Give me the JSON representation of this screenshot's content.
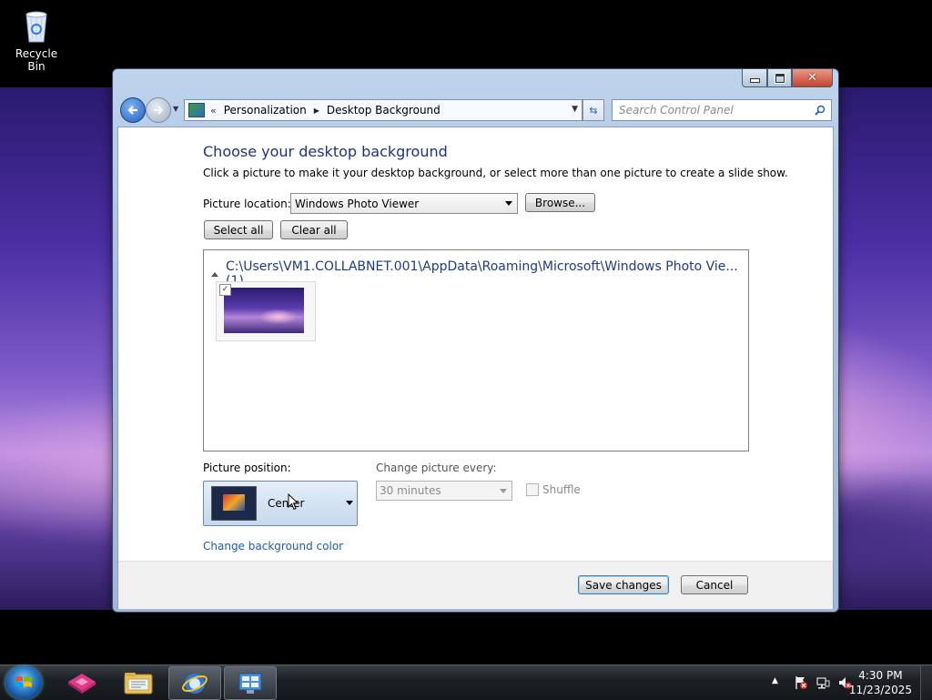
{
  "desktop": {
    "icons": [
      {
        "label": "Recycle Bin",
        "icon": "recycle-bin-icon"
      }
    ]
  },
  "window": {
    "controls": {
      "minimize": "minimize",
      "maximize": "maximize",
      "close": "close"
    },
    "address": {
      "chevron": "«",
      "breadcrumbs": [
        "Personalization",
        "Desktop Background"
      ]
    },
    "search": {
      "placeholder": "Search Control Panel"
    },
    "heading": "Choose your desktop background",
    "subtext": "Click a picture to make it your desktop background, or select more than one picture to create a slide show.",
    "picture_location": {
      "label": "Picture location:",
      "value": "Windows Photo Viewer",
      "browse": "Browse..."
    },
    "select_all": "Select all",
    "clear_all": "Clear all",
    "gallery": {
      "group_header": "C:\\Users\\VM1.COLLABNET.001\\AppData\\Roaming\\Microsoft\\Windows Photo Vie... (1)",
      "pictures": [
        {
          "checked": true
        }
      ]
    },
    "picture_position": {
      "label": "Picture position:",
      "value": "Center"
    },
    "change_every": {
      "label": "Change picture every:",
      "value": "30 minutes",
      "enabled": false
    },
    "shuffle": {
      "label": "Shuffle",
      "checked": false,
      "enabled": false
    },
    "change_bg_color": "Change background color",
    "save": "Save changes",
    "cancel": "Cancel"
  },
  "taskbar": {
    "pinned": [
      "start-orb",
      "app-icon",
      "windows-explorer-icon",
      "internet-explorer-icon",
      "control-panel-icon"
    ],
    "clock": {
      "time": "4:30 PM",
      "date": "11/23/2025"
    }
  },
  "colors": {
    "heading": "#1e3287",
    "link": "#1e5bb5"
  }
}
